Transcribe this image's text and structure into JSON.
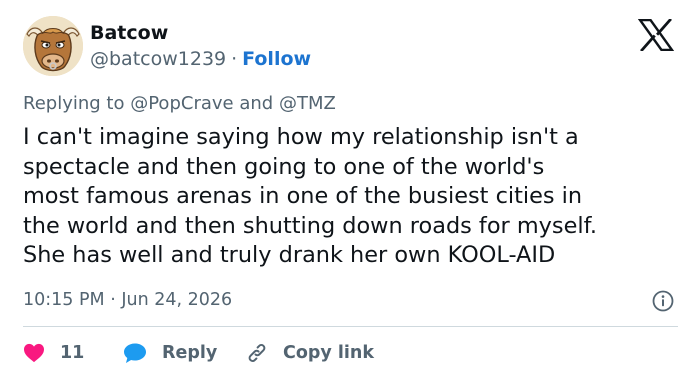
{
  "author": {
    "display_name": "Batcow",
    "handle": "@batcow1239",
    "separator": "·",
    "follow_label": "Follow",
    "avatar_icon": "bull-avatar"
  },
  "brand": {
    "logo_icon": "x-logo"
  },
  "reply_context": {
    "prefix": "Replying to",
    "mentions": [
      "@PopCrave",
      "@TMZ"
    ],
    "joiner": "and"
  },
  "tweet": {
    "lines": [
      "I can't imagine saying how my relationship isn't a",
      "spectacle and then going to one of the world's",
      "most famous arenas in one of the busiest cities in",
      "the world and then shutting down roads for myself.",
      "She has well and truly drank her own KOOL-AID"
    ],
    "timestamp": "10:15 PM · Jun 24, 2026",
    "info_icon": "info-icon"
  },
  "actions": {
    "like": {
      "count": "11",
      "icon": "heart-icon"
    },
    "reply": {
      "label": "Reply",
      "icon": "chat-bubble-icon"
    },
    "copy_link": {
      "label": "Copy link",
      "icon": "link-icon"
    }
  },
  "colors": {
    "accent": "#1d74d0",
    "text_primary": "#0f1419",
    "text_secondary": "#536471",
    "like": "#f91880",
    "reply_icon": "#1d9bf0",
    "divider": "#cfd9de"
  }
}
